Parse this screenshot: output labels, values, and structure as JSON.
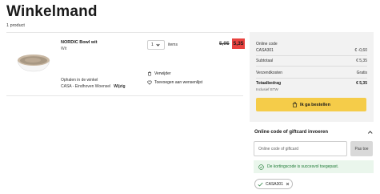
{
  "page": {
    "title": "Winkelmand",
    "product_count": "1 product"
  },
  "item": {
    "name": "NORDIC Bowl wit",
    "color": "Wit",
    "quantity": "1",
    "quantity_unit": "items",
    "old_price": "5,95",
    "price": "5,35",
    "pickup_label": "Ophalen in de winkel",
    "pickup_store": "CASA - Eindhoven Woensel",
    "change_label": "Wijzig",
    "remove_label": "Verwijder",
    "wishlist_label": "Toevoegen aan wensenlijst"
  },
  "summary": {
    "online_code_label": "Online code",
    "code": "CASA301",
    "code_discount": "€ -0,60",
    "subtotal_label": "Subtotaal",
    "subtotal": "€ 5,35",
    "shipping_label": "Verzendkosten",
    "shipping": "Gratis",
    "total_label": "Totaalbedrag",
    "total": "€ 5,35",
    "vat_note": "Inclusief BTW",
    "checkout_label": "Ik ga bestellen"
  },
  "giftcard": {
    "header": "Online code of giftcard invoeren",
    "input_placeholder": "Online code of giftcard",
    "submit_label": "Pas toe",
    "success_message": "De kortingscode is succesvol toegepast.",
    "applied_code": "CASA301"
  },
  "colors": {
    "accent_yellow": "#f5cc49",
    "sale_red": "#e8423f",
    "success_green": "#1e7a35",
    "panel_gray": "#f2f2f2"
  },
  "icons": [
    "shopping-bag-icon",
    "trash-icon",
    "heart-icon",
    "check-circle-icon",
    "check-icon",
    "close-icon",
    "chevron-down-icon",
    "chevron-up-icon"
  ]
}
